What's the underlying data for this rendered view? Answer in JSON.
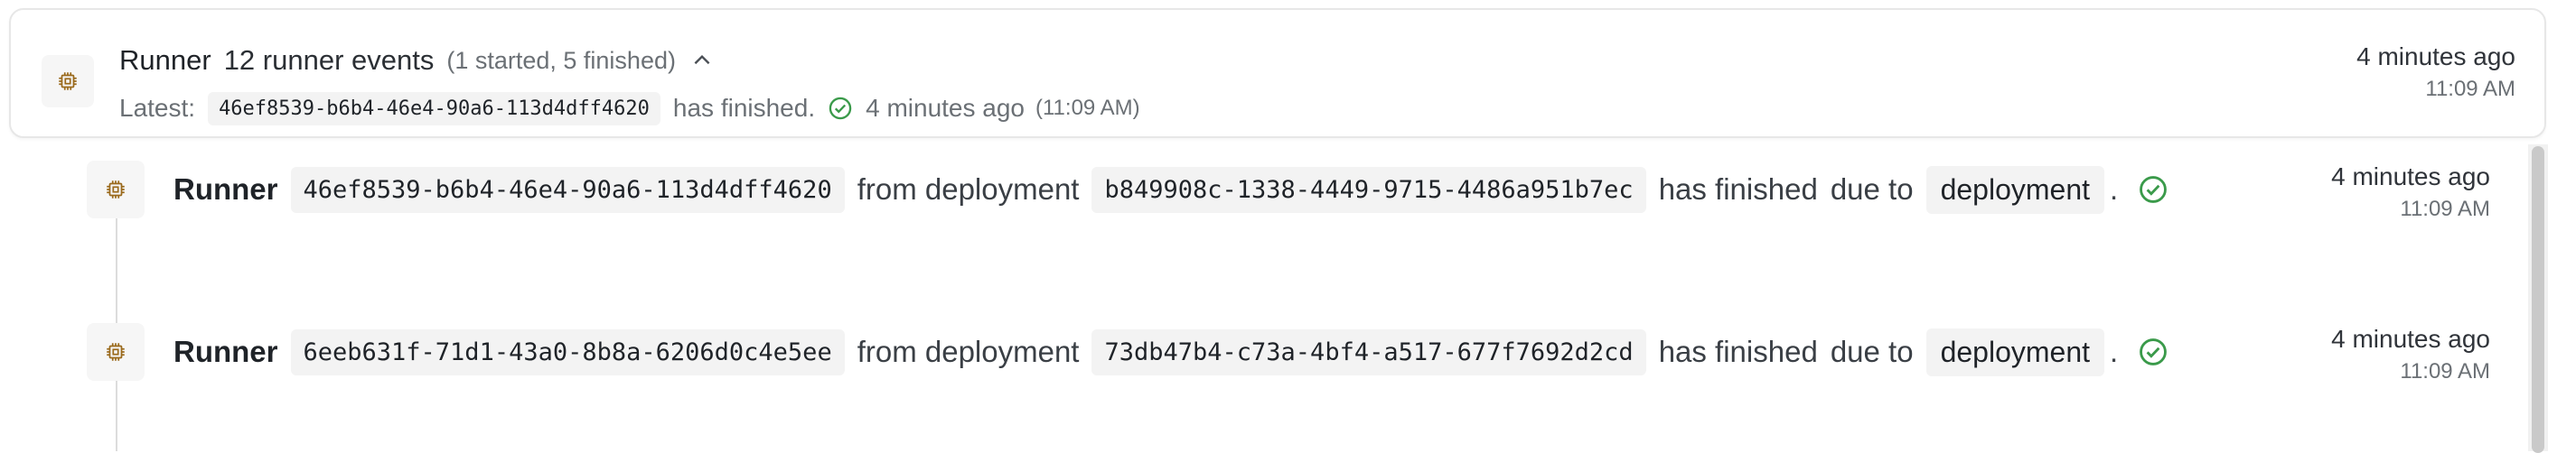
{
  "group": {
    "icon": "runner-chip-icon",
    "title": "Runner",
    "count": "12 runner events",
    "breakdown": "(1 started, 5 finished)",
    "latest_label": "Latest:",
    "latest_id": "46ef8539-b6b4-46e4-90a6-113d4dff4620",
    "latest_status": "has finished.",
    "latest_rel_time": "4 minutes ago",
    "latest_abs_time": "(11:09 AM)",
    "time_relative": "4 minutes ago",
    "time_absolute": "11:09 AM"
  },
  "events": [
    {
      "title": "Runner",
      "runner_id": "46ef8539-b6b4-46e4-90a6-113d4dff4620",
      "from_text": "from deployment",
      "deployment_id": "b849908c-1338-4449-9715-4486a951b7ec",
      "status_text": "has finished",
      "due_text": "due to",
      "reason": "deployment",
      "period": ".",
      "time_relative": "4 minutes ago",
      "time_absolute": "11:09 AM"
    },
    {
      "title": "Runner",
      "runner_id": "6eeb631f-71d1-43a0-8b8a-6206d0c4e5ee",
      "from_text": "from deployment",
      "deployment_id": "73db47b4-c73a-4bf4-a517-677f7692d2cd",
      "status_text": "has finished",
      "due_text": "due to",
      "reason": "deployment",
      "period": ".",
      "time_relative": "4 minutes ago",
      "time_absolute": "11:09 AM"
    }
  ],
  "colors": {
    "success": "#3a9a4a",
    "chip_icon": "#9a6a1c"
  }
}
